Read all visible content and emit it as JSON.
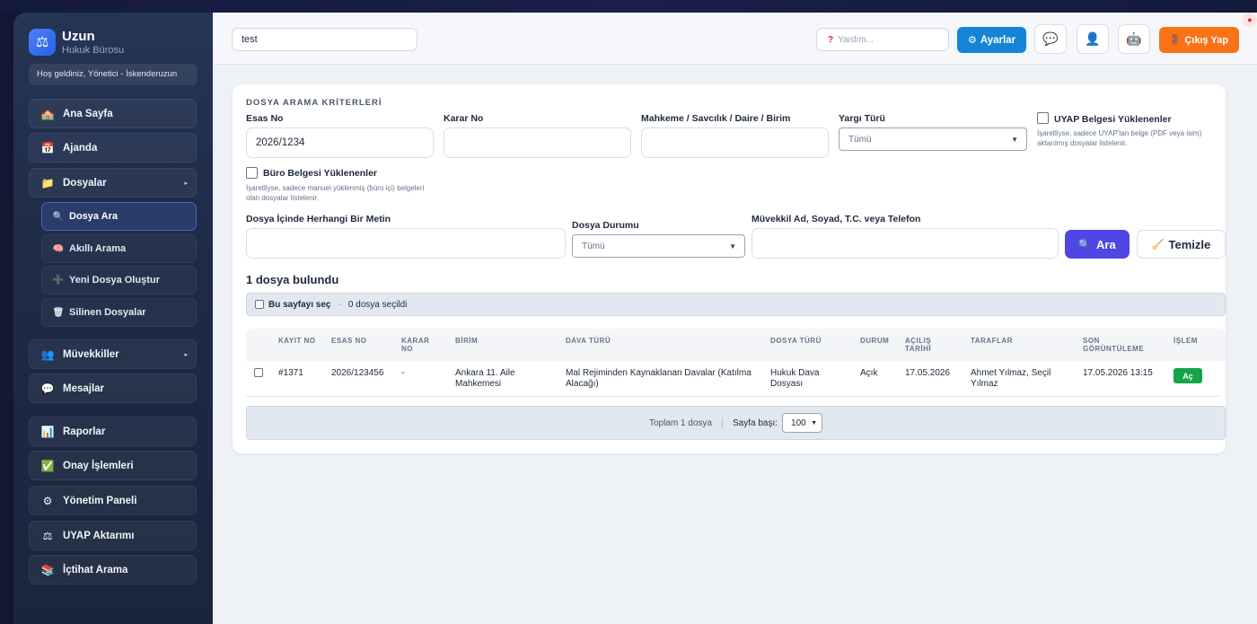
{
  "sidebar": {
    "brand_name": "Uzun",
    "brand_subtitle": "Hukuk Bürosu",
    "welcome": "Hoş geldiniz, Yönetici - İskenderuzun",
    "items": [
      {
        "label": "Ana Sayfa",
        "icon": "🏫"
      },
      {
        "label": "Ajanda",
        "icon": "📅"
      },
      {
        "label": "Dosyalar",
        "icon": "📁"
      },
      {
        "label": "Müvekkiller",
        "icon": "👥"
      },
      {
        "label": "Mesajlar",
        "icon": "💬"
      },
      {
        "label": "Raporlar",
        "icon": "📊"
      },
      {
        "label": "Onay İşlemleri",
        "icon": "✅"
      },
      {
        "label": "Yönetim Paneli",
        "icon": "⚙"
      },
      {
        "label": "UYAP Aktarımı",
        "icon": "⚖"
      },
      {
        "label": "İçtihat Arama",
        "icon": "📚"
      }
    ],
    "subitems": [
      {
        "label": "Dosya Ara",
        "icon": "🔍"
      },
      {
        "label": "Akıllı Arama",
        "icon": "🧠"
      },
      {
        "label": "Yeni Dosya Oluştur",
        "icon": "➕"
      },
      {
        "label": "Silinen Dosyalar",
        "icon": "🗑"
      }
    ]
  },
  "header": {
    "search_value": "test",
    "help_placeholder": "Yardım...",
    "settings_label": "Ayarlar",
    "logout_label": "Çıkış Yap"
  },
  "search": {
    "section_title": "DOSYA ARAMA KRİTERLERİ",
    "esas_no_label": "Esas No",
    "esas_no_value": "2026/1234",
    "karar_no_label": "Karar No",
    "karar_no_value": "",
    "mahkeme_label": "Mahkeme / Savcılık / Daire / Birim",
    "mahkeme_value": "",
    "yargi_turu_label": "Yargı Türü",
    "yargi_turu_value": "Tümü",
    "uyap_label": "UYAP Belgesi Yüklenenler",
    "uyap_hint": "İşaretliyse, sadece UYAP'tan belge (PDF veya isim) aktarılmış dosyalar listelenir.",
    "buro_label": "Büro Belgesi Yüklenenler",
    "buro_hint": "İşaretliyse, sadece manuel yüklenmiş (büro içi) belgeleri olan dosyalar listelenir.",
    "metin_label": "Dosya İçinde Herhangi Bir Metin",
    "metin_value": "",
    "durum_label": "Dosya Durumu",
    "durum_value": "Tümü",
    "muvekkil_label": "Müvekkil Ad, Soyad, T.C. veya Telefon",
    "muvekkil_value": "",
    "search_button": "Ara",
    "clear_button": "Temizle"
  },
  "results": {
    "found_text": "1 dosya bulundu",
    "select_page_label": "Bu sayfayı seç",
    "selected_count": "0 dosya seçildi",
    "columns": {
      "kayit_no": "KAYIT NO",
      "esas_no": "ESAS NO",
      "karar_no_1": "KARAR",
      "karar_no_2": "NO",
      "birim": "BİRİM",
      "dava_turu": "DAVA TÜRÜ",
      "dosya_turu": "DOSYA TÜRÜ",
      "durum": "DURUM",
      "acilis_1": "AÇILIŞ",
      "acilis_2": "TARİHİ",
      "taraflar": "TARAFLAR",
      "son_1": "SON",
      "son_2": "GÖRÜNTÜLEME",
      "islem": "İŞLEM"
    },
    "rows": [
      {
        "kayit_no": "#1371",
        "esas_no": "2026/123456",
        "karar_no": "-",
        "birim_1": "Ankara 11. Aile",
        "birim_2": "Mahkemesi",
        "dava_turu_1": "Mal Rejiminden Kaynaklanan Davalar (Katılma",
        "dava_turu_2": "Alacağı)",
        "dosya_turu_1": "Hukuk Dava",
        "dosya_turu_2": "Dosyası",
        "durum": "Açık",
        "acilis": "17.05.2026",
        "taraflar_1": "Ahmet Yılmaz, Seçil",
        "taraflar_2": "Yılmaz",
        "son_goruntuleme": "17.05.2026 13:15",
        "action": "Aç"
      }
    ],
    "total_text": "Toplam 1 dosya",
    "per_page_label": "Sayfa başı:",
    "per_page_value": "100"
  },
  "icons": {
    "logo": "scale-icon",
    "help": "question-icon",
    "settings": "gear-icon",
    "chat_bot": "chat-bot-icon",
    "user": "user-icon",
    "robot": "robot-icon",
    "logout": "door-icon"
  },
  "colors": {
    "primary": "#1583d6",
    "search_button": "#4f46e5",
    "logout": "#f97316",
    "open_button": "#16a34a",
    "sidebar": "#1e2b47"
  }
}
